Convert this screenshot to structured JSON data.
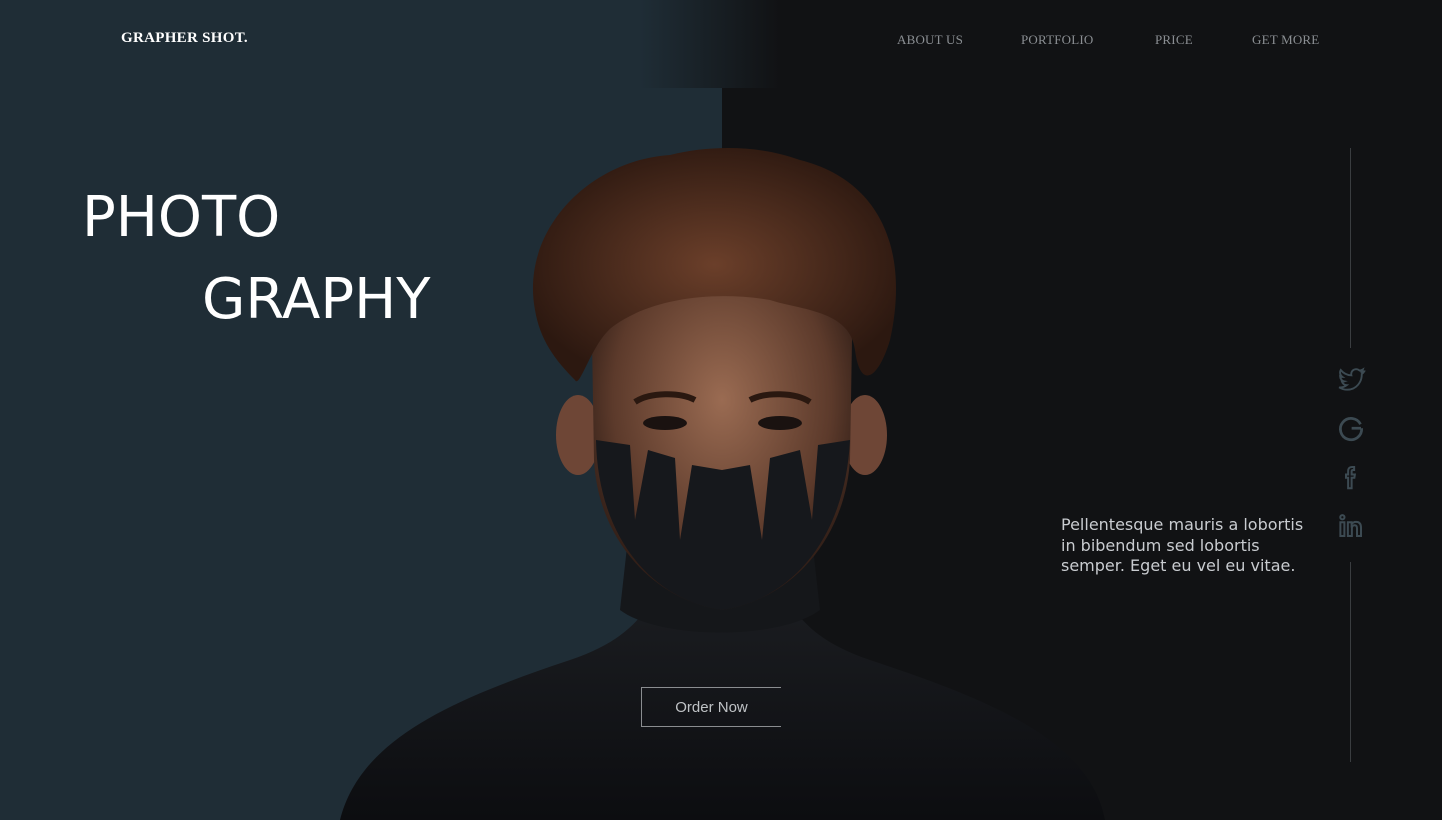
{
  "brand": {
    "logo": "GRAPHER SHOT."
  },
  "nav": {
    "items": [
      {
        "label": "ABOUT US"
      },
      {
        "label": "PORTFOLIO"
      },
      {
        "label": "PRICE"
      },
      {
        "label": "GET MORE"
      }
    ]
  },
  "hero": {
    "line1": "PHOTO",
    "line2": "GRAPHY",
    "cta_label": "Order Now",
    "tagline": "Pellentesque mauris a lobortis in bibendum sed lobortis semper. Eget eu vel eu vitae."
  },
  "social": {
    "icons": [
      "twitter-icon",
      "google-icon",
      "facebook-icon",
      "linkedin-icon"
    ],
    "color": "#3c4a52"
  },
  "colors": {
    "left_panel": "#1f2d36",
    "right_panel": "#111214",
    "heading": "#ffffff",
    "nav_text": "#8b8f93"
  }
}
